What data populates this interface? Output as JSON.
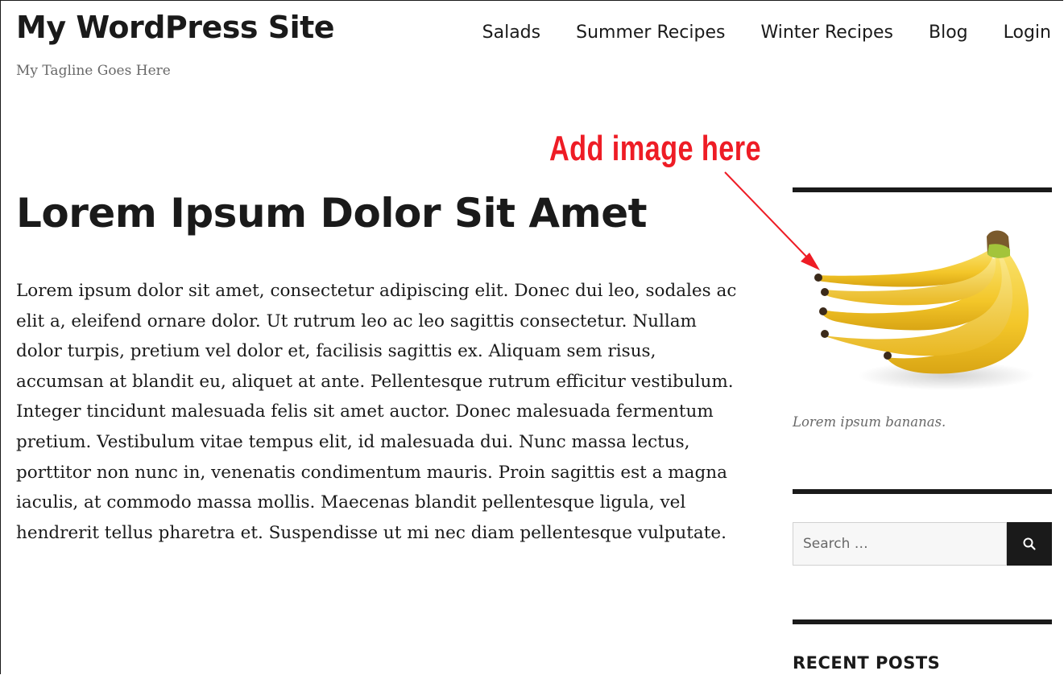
{
  "site": {
    "title": "My WordPress Site",
    "tagline": "My Tagline Goes Here"
  },
  "nav": {
    "items": [
      {
        "label": "Salads"
      },
      {
        "label": "Summer Recipes"
      },
      {
        "label": "Winter Recipes"
      },
      {
        "label": "Blog"
      },
      {
        "label": "Login"
      }
    ]
  },
  "annotation": {
    "text": "Add image here",
    "color": "#ee1c25"
  },
  "post": {
    "title": "Lorem Ipsum Dolor Sit Amet",
    "body": "Lorem ipsum dolor sit amet, consectetur adipiscing elit. Donec dui leo, sodales ac elit a, eleifend ornare dolor. Ut rutrum leo ac leo sagittis consectetur. Nullam dolor turpis, pretium vel dolor et, facilisis sagittis ex. Aliquam sem risus, accumsan at blandit eu, aliquet at ante. Pellentesque rutrum efficitur vestibulum. Integer tincidunt malesuada felis sit amet auctor. Donec malesuada fermentum pretium. Vestibulum vitae tempus elit, id malesuada dui. Nunc massa lectus, porttitor non nunc in, venenatis condimentum mauris. Proin sagittis est a magna iaculis, at commodo massa mollis. Maecenas blandit pellentesque ligula, vel hendrerit tellus pharetra et. Suspendisse ut mi nec diam pellentesque vulputate."
  },
  "sidebar": {
    "image_widget": {
      "image": "banana-bunch-image",
      "caption": "Lorem ipsum bananas."
    },
    "search_widget": {
      "placeholder": "Search …",
      "icon": "search-icon"
    },
    "recent_posts_widget": {
      "title": "RECENT POSTS"
    }
  },
  "colors": {
    "text": "#1a1a1a",
    "secondary_text": "#686868",
    "annotation": "#ee1c25",
    "search_button": "#1a1a1a"
  }
}
